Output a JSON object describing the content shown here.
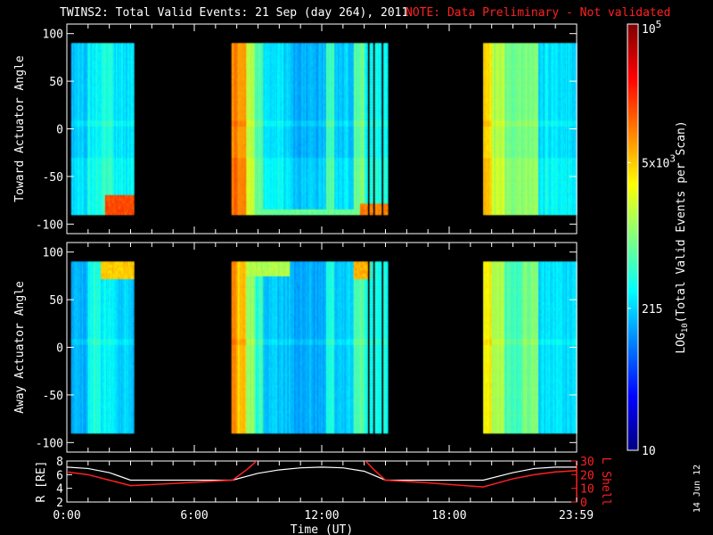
{
  "title": "TWINS2: Total Valid Events: 21 Sep (day 264), 2011",
  "note": "NOTE: Data Preliminary - Not validated",
  "date_stamp": "14 Jun 12",
  "chart_data": {
    "type": "heatmap",
    "title": "TWINS2: Total Valid Events: 21 Sep (day 264), 2011",
    "xlabel": "Time (UT)",
    "xlim_hours": [
      0,
      24
    ],
    "x_ticks": [
      "0:00",
      "6:00",
      "12:00",
      "18:00",
      "23:59"
    ],
    "x_tick_hours": [
      0,
      6,
      12,
      18,
      23.98
    ],
    "coverage_hours": [
      [
        0.2,
        3.1
      ],
      [
        7.7,
        15.1
      ],
      [
        19.6,
        24
      ]
    ],
    "gaps_hours": [
      14.18,
      14.43,
      14.81
    ],
    "panels": [
      {
        "ylabel": "Toward Actuator Angle",
        "ylim": [
          -110,
          110
        ],
        "y_ticks": [
          "100",
          "50",
          "0",
          "-50",
          "-100"
        ],
        "y_tick_values": [
          100,
          50,
          0,
          -50,
          -100
        ],
        "data_angle_range": [
          -90,
          90
        ],
        "column_log10_profile": [
          [
            0.2,
            1.0,
            2.3
          ],
          [
            1.0,
            1.6,
            2.5
          ],
          [
            1.6,
            2.2,
            2.6
          ],
          [
            2.2,
            3.1,
            2.4
          ],
          [
            7.7,
            8.0,
            4.0
          ],
          [
            8.0,
            8.4,
            3.8
          ],
          [
            8.4,
            8.8,
            3.2
          ],
          [
            8.8,
            9.2,
            2.8
          ],
          [
            9.2,
            10.5,
            2.4
          ],
          [
            10.5,
            12.2,
            2.2
          ],
          [
            12.2,
            12.6,
            2.7
          ],
          [
            12.6,
            13.5,
            2.3
          ],
          [
            13.5,
            14.0,
            2.9
          ],
          [
            14.0,
            15.1,
            2.5
          ],
          [
            19.6,
            20.0,
            3.6
          ],
          [
            20.0,
            20.6,
            3.2
          ],
          [
            20.6,
            21.4,
            2.9
          ],
          [
            21.4,
            22.2,
            3.0
          ],
          [
            22.2,
            24,
            2.4
          ]
        ],
        "edge_enhancements": [
          {
            "hours": [
              1.8,
              3.1
            ],
            "angle": [
              -90,
              -70
            ],
            "log10": 4.2
          },
          {
            "hours": [
              7.7,
              15.1
            ],
            "angle": [
              -90,
              -84
            ],
            "log10": 2.9
          },
          {
            "hours": [
              13.8,
              15.1
            ],
            "angle": [
              -90,
              -80
            ],
            "log10": 4.0
          }
        ]
      },
      {
        "ylabel": "Away Actuator Angle",
        "ylim": [
          -110,
          110
        ],
        "y_ticks": [
          "100",
          "50",
          "0",
          "-50",
          "-100"
        ],
        "y_tick_values": [
          100,
          50,
          0,
          -50,
          -100
        ],
        "data_angle_range": [
          -90,
          90
        ],
        "column_log10_profile": [
          [
            0.2,
            1.0,
            2.2
          ],
          [
            1.0,
            1.6,
            2.6
          ],
          [
            1.6,
            2.2,
            2.5
          ],
          [
            2.2,
            3.1,
            2.3
          ],
          [
            7.7,
            8.0,
            3.9
          ],
          [
            8.0,
            8.4,
            3.7
          ],
          [
            8.4,
            8.8,
            3.1
          ],
          [
            8.8,
            9.2,
            2.7
          ],
          [
            9.2,
            10.5,
            2.3
          ],
          [
            10.5,
            12.2,
            2.2
          ],
          [
            12.2,
            12.6,
            2.6
          ],
          [
            12.6,
            13.5,
            2.3
          ],
          [
            13.5,
            14.0,
            2.8
          ],
          [
            14.0,
            15.1,
            2.6
          ],
          [
            19.6,
            20.0,
            3.5
          ],
          [
            20.0,
            20.6,
            3.2
          ],
          [
            20.6,
            21.4,
            2.8
          ],
          [
            21.4,
            22.2,
            3.0
          ],
          [
            22.2,
            24,
            2.4
          ]
        ],
        "edge_enhancements": [
          {
            "hours": [
              1.6,
              3.1
            ],
            "angle": [
              70,
              90
            ],
            "log10": 3.7
          },
          {
            "hours": [
              8.4,
              10.5
            ],
            "angle": [
              75,
              90
            ],
            "log10": 3.2
          },
          {
            "hours": [
              13.5,
              14.3
            ],
            "angle": [
              70,
              90
            ],
            "log10": 3.8
          }
        ]
      }
    ],
    "colorbar": {
      "label": "LOG10(Total Valid Events per Scan)",
      "label_log": "LOG",
      "label_sub": "10",
      "label_rest": "(Total Valid Events per Scan)",
      "range": [
        10,
        100000
      ],
      "ticks": [
        {
          "value": 100000,
          "label": "10",
          "sup": "5"
        },
        {
          "value": 5000,
          "label": "5x10",
          "sup": "3"
        },
        {
          "value": 215,
          "label": "215",
          "sup": ""
        },
        {
          "value": 10,
          "label": "10",
          "sup": ""
        }
      ]
    },
    "orbit": {
      "left_label": "R [RE]",
      "right_label": "L Shell",
      "left_ylim": [
        2,
        8
      ],
      "left_ticks": [
        "8",
        "6",
        "4",
        "2"
      ],
      "right_ylim": [
        0,
        30
      ],
      "right_ticks": [
        "30",
        "20",
        "10",
        "0"
      ],
      "R_series": {
        "color": "#ffffff",
        "hours": [
          0,
          1,
          2,
          3,
          5,
          7.8,
          9,
          10,
          11,
          12,
          13,
          14,
          15,
          17,
          19.6,
          21,
          22,
          23,
          24
        ],
        "values": [
          7.1,
          6.9,
          6.3,
          5.2,
          5.2,
          5.2,
          6.2,
          6.7,
          7.0,
          7.1,
          7.0,
          6.5,
          5.2,
          5.2,
          5.2,
          6.3,
          6.9,
          7.1,
          7.1
        ]
      },
      "L_series": {
        "color": "#ff2020",
        "hours": [
          0,
          1,
          2,
          3,
          5,
          7.8,
          8.5,
          9,
          14,
          14.5,
          15,
          17,
          19.6,
          21,
          22,
          23,
          24
        ],
        "values": [
          22,
          20,
          16,
          12,
          13.5,
          16,
          24,
          31,
          31,
          23,
          16,
          14,
          11,
          17,
          20,
          22,
          23
        ]
      }
    }
  },
  "colors": {
    "note": "#ff2020",
    "L_shell": "#ff2020",
    "R": "#ffffff"
  }
}
